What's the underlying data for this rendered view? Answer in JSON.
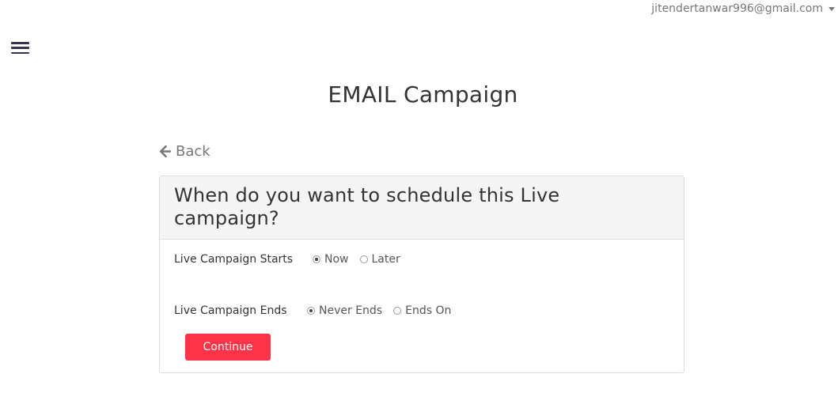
{
  "header": {
    "user_email": "jitendertanwar996@gmail.com"
  },
  "page": {
    "title": "EMAIL Campaign",
    "back_label": "Back"
  },
  "card": {
    "heading": "When do you want to schedule this Live campaign?",
    "starts": {
      "label": "Live Campaign Starts",
      "options": [
        "Now",
        "Later"
      ],
      "selected": "Now"
    },
    "ends": {
      "label": "Live Campaign Ends",
      "options": [
        "Never Ends",
        "Ends On"
      ],
      "selected": "Never Ends"
    },
    "continue_label": "Continue"
  },
  "colors": {
    "primary_button": "#ff3347"
  },
  "icons": {
    "menu": "hamburger-menu-icon",
    "back": "arrow-left-icon",
    "user_dropdown": "caret-down-icon",
    "radio_checked": "radio-checked-icon",
    "radio_unchecked": "radio-unchecked-icon"
  }
}
